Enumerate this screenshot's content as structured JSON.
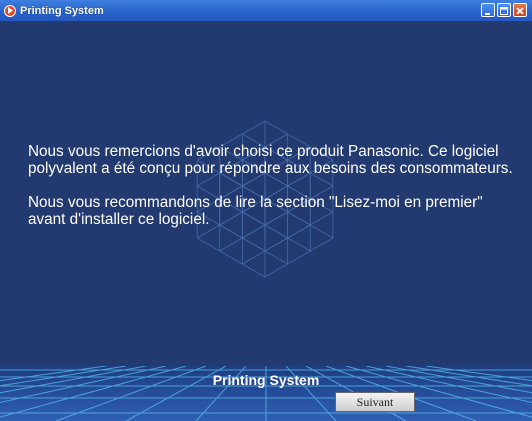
{
  "window": {
    "title": "Printing System"
  },
  "message": {
    "paragraph1": "Nous vous remercions d'avoir choisi ce produit Panasonic. Ce logiciel polyvalent a été conçu pour répondre aux besoins des consommateurs.",
    "paragraph2": "Nous vous recommandons de lire la section \"Lisez-moi en premier\" avant d'installer ce logiciel."
  },
  "footer": {
    "title": "Printing System",
    "next_label": "Suivant"
  },
  "icons": {
    "app": "play-icon",
    "minimize": "minimize-icon",
    "maximize": "maximize-icon",
    "close": "close-icon",
    "background": "wireframe-cube-icon"
  },
  "colors": {
    "background": "#223a70",
    "titlebar": "#2a64cc",
    "close_button": "#c8401f",
    "text": "#ffffff"
  }
}
